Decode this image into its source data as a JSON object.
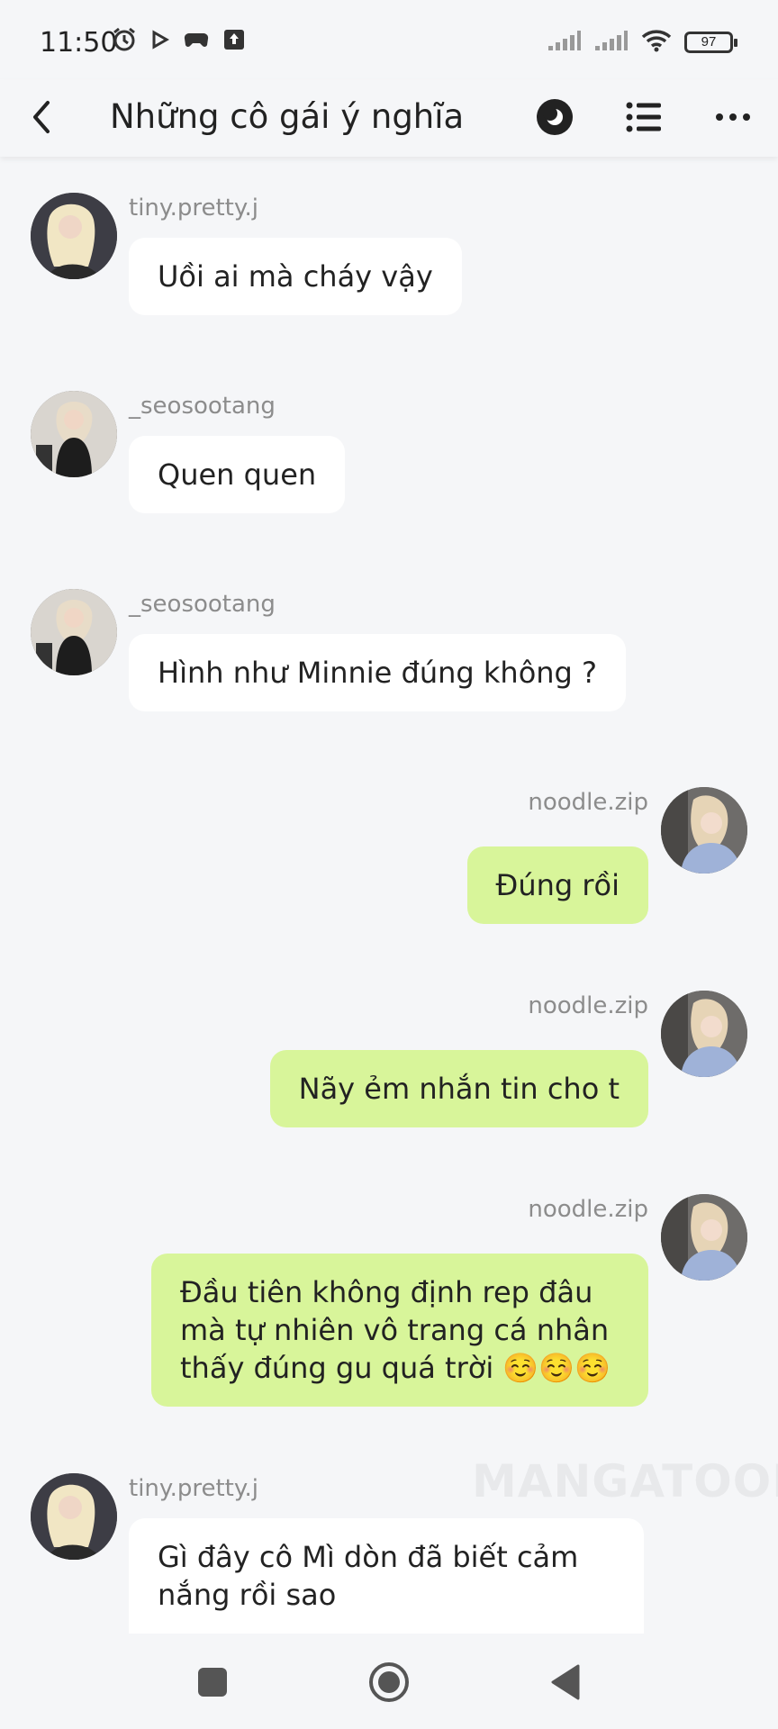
{
  "status_bar": {
    "time": "11:50",
    "battery": "97",
    "icons": [
      "alarm-icon",
      "play-icon",
      "gamepad-icon",
      "upload-icon",
      "signal-icon",
      "signal-icon",
      "wifi-icon",
      "battery-icon"
    ]
  },
  "header": {
    "title": "Những cô gái ý nghĩa",
    "back_icon": "chevron-left-icon",
    "actions": [
      "night-mode-icon",
      "list-icon",
      "more-icon"
    ]
  },
  "messages": [
    {
      "side": "left",
      "username": "tiny.pretty.j",
      "text": "Uồi ai mà cháy vậy"
    },
    {
      "side": "left",
      "username": "_seosootang",
      "text": "Quen quen"
    },
    {
      "side": "left",
      "username": "_seosootang",
      "text": "Hình như Minnie đúng không ?"
    },
    {
      "side": "right",
      "username": "noodle.zip",
      "text": "Đúng rồi"
    },
    {
      "side": "right",
      "username": "noodle.zip",
      "text": "Nãy ẻm nhắn tin cho t"
    },
    {
      "side": "right",
      "username": "noodle.zip",
      "text": "Đầu tiên không định rep đâu mà tự nhiên vô trang cá nhân thấy đúng gu quá trời ☺️☺️☺️"
    },
    {
      "side": "left",
      "username": "tiny.pretty.j",
      "text": "Gì đây cô Mì dòn đã biết cảm nắng rồi sao"
    }
  ],
  "watermark": "MANGATOON",
  "colors": {
    "background": "#f5f6f8",
    "bubble_left": "#ffffff",
    "bubble_right": "#d8f59a",
    "username": "#8c8c8c"
  },
  "nav_bar": [
    "recents-icon",
    "home-icon",
    "back-icon"
  ]
}
